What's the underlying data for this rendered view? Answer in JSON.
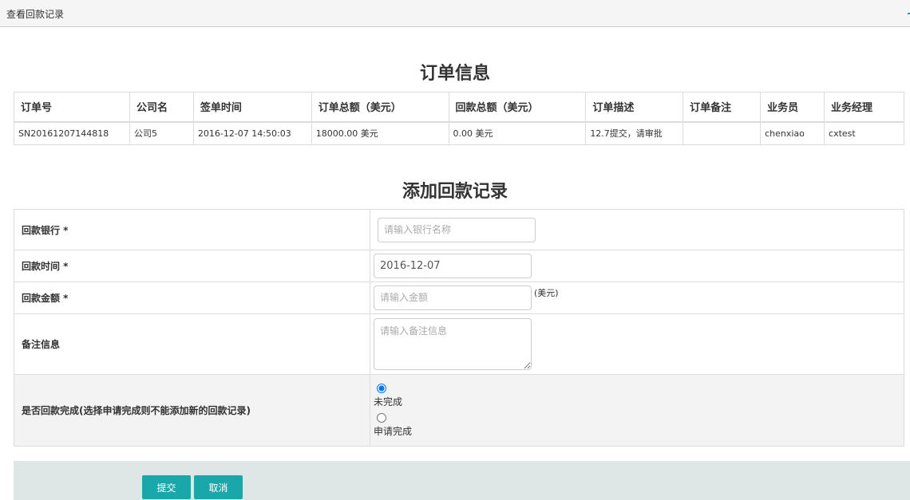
{
  "header": {
    "title": "查看回款记录"
  },
  "order_section": {
    "title": "订单信息",
    "columns": [
      "订单号",
      "公司名",
      "签单时间",
      "订单总额（美元）",
      "回款总额（美元）",
      "订单描述",
      "订单备注",
      "业务员",
      "业务经理"
    ],
    "row": [
      "SN20161207144818",
      "公司5",
      "2016-12-07 14:50:03",
      "18000.00 美元",
      "0.00 美元",
      "12.7提交，请审批",
      "",
      "chenxiao",
      "cxtest"
    ]
  },
  "form_section": {
    "title": "添加回款记录",
    "bank": {
      "label": "回款银行 *",
      "placeholder": "请输入银行名称",
      "value": ""
    },
    "date": {
      "label": "回款时间 *",
      "value": "2016-12-07"
    },
    "amount": {
      "label": "回款金额 *",
      "placeholder": "请输入金额",
      "value": "",
      "unit": "(美元)"
    },
    "note": {
      "label": "备注信息",
      "placeholder": "请输入备注信息"
    },
    "complete": {
      "label": "是否回款完成(选择申请完成则不能添加新的回款记录)",
      "options": [
        {
          "label": "未完成",
          "checked": true
        },
        {
          "label": "申请完成",
          "checked": false
        }
      ]
    }
  },
  "actions": {
    "submit": "提交",
    "cancel": "取消"
  },
  "colors": {
    "accent": "#1aa7a9",
    "action_bar": "#dfe6e6"
  }
}
